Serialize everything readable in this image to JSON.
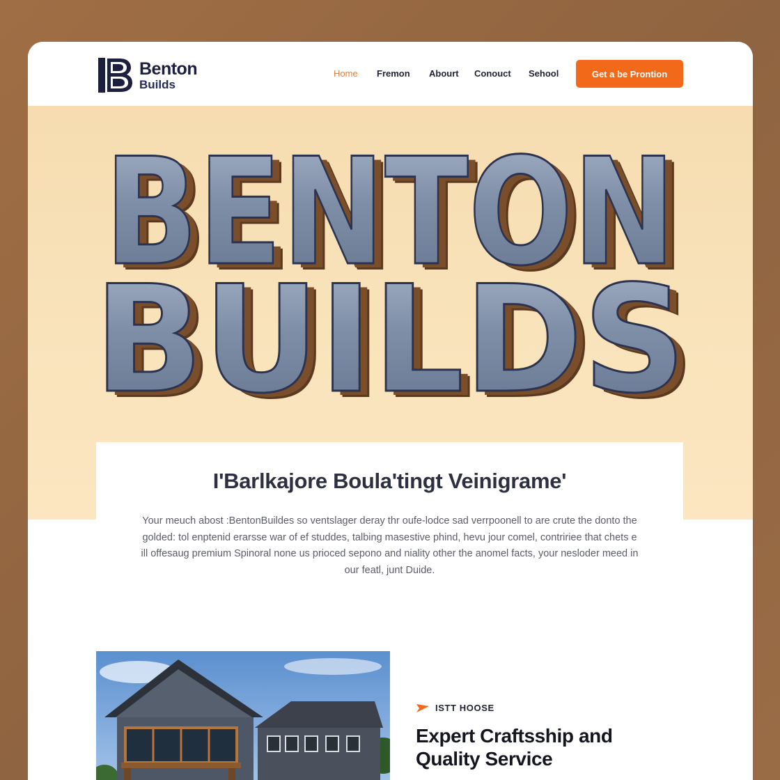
{
  "brand": {
    "name": "Benton",
    "sub": "Builds",
    "mark_letter": "B"
  },
  "nav": {
    "items": [
      {
        "label": "Home",
        "active": true
      },
      {
        "label": "Fremon",
        "active": false
      },
      {
        "label": "Abourt",
        "active": false
      },
      {
        "label": "Conouct",
        "active": false
      },
      {
        "label": "Sehool",
        "active": false
      }
    ],
    "cta_label": "Get a be Prontion"
  },
  "hero": {
    "line1": "BENTON",
    "line2": "BUILDS"
  },
  "intro": {
    "title": "I'Barlkajore Boula'tingt Veinigrame'",
    "body": "Your meuch abost :BentonBuildes so ventslager deray thr oufe-lodce sad verrpoonell to are crute the donto the golded: tol enptenid erarsse war of ef studdes, talbing masestive phind, hevu jour comel, contririee that chets e ill offesaug premium Spinoral none us prioced sepono and niality other the anomel facts, your nesloder meed in our featl, junt Duide."
  },
  "feature": {
    "tag": "ISTT HOOSE",
    "heading_line1": "Expert Craftsship and",
    "heading_line2": "Quality Service"
  },
  "colors": {
    "accent": "#f26a19",
    "nav_active": "#f07a27",
    "brand_navy": "#1c1f3d",
    "hero_bg": "#f8e0b6",
    "letter_face": "#7f8ea8",
    "letter_shadow": "#6b4322"
  }
}
